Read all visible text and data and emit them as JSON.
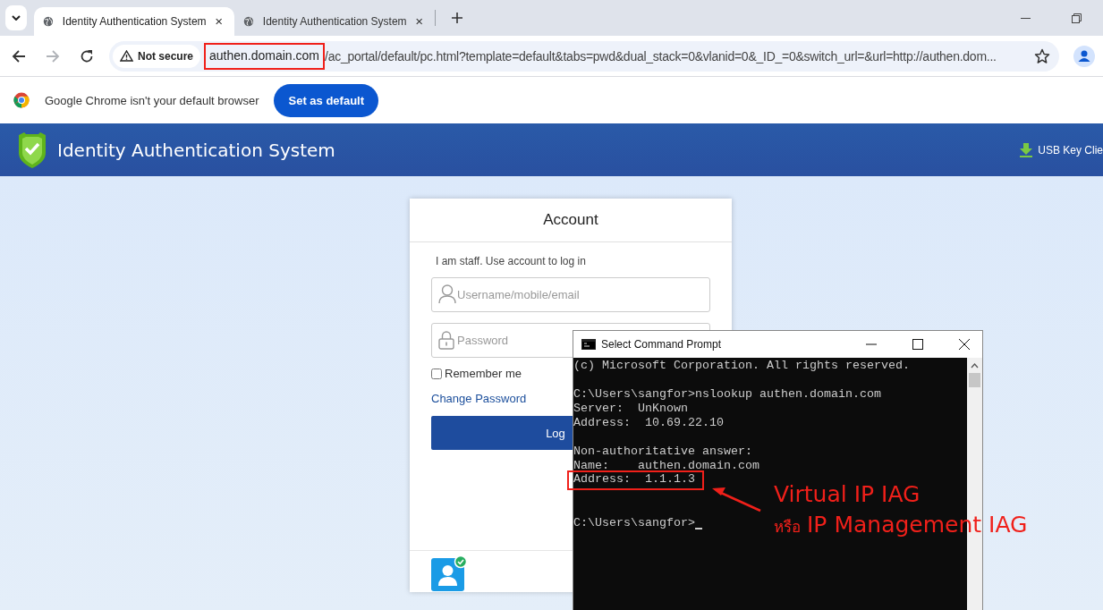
{
  "browser": {
    "tabs": [
      {
        "title": "Identity Authentication System",
        "selected": true
      },
      {
        "title": "Identity Authentication System",
        "selected": false
      }
    ],
    "toolbar": {
      "forward_disabled": true,
      "security_label": "Not secure",
      "url_host": "authen.domain.com",
      "url_host_highlighted": true,
      "url_rest": "/ac_portal/default/pc.html?template=default&tabs=pwd&dual_stack=0&vlanid=0&_ID_=0&switch_url=&url=http://authen.dom..."
    },
    "infobar": {
      "message": "Google Chrome isn't your default browser",
      "button": "Set as default"
    }
  },
  "page": {
    "header": {
      "title": "Identity Authentication System",
      "link": "USB Key Clie"
    },
    "login_card": {
      "title": "Account",
      "subtitle": "I am staff. Use account to log in",
      "username_placeholder": "Username/mobile/email",
      "password_placeholder": "Password",
      "remember": {
        "label": "Remember me",
        "checked": false
      },
      "change_password": "Change Password",
      "login_button": "Log"
    }
  },
  "command_prompt": {
    "title": "Select Command Prompt",
    "lines": [
      {
        "kind": "text",
        "text": "(c) Microsoft Corporation. All rights reserved.",
        "highlighted": false
      },
      {
        "kind": "blank"
      },
      {
        "kind": "text",
        "text": "C:\\Users\\sangfor>nslookup authen.domain.com",
        "highlighted": false
      },
      {
        "kind": "text",
        "text": "Server:  UnKnown",
        "highlighted": false
      },
      {
        "kind": "text",
        "text": "Address:  10.69.22.10",
        "highlighted": false
      },
      {
        "kind": "blank"
      },
      {
        "kind": "text",
        "text": "Non-authoritative answer:",
        "highlighted": false
      },
      {
        "kind": "text",
        "text": "Name:    authen.domain.com",
        "highlighted": false
      },
      {
        "kind": "text",
        "text": "Address:  1.1.1.3",
        "highlighted": true
      },
      {
        "kind": "blank"
      },
      {
        "kind": "blank"
      },
      {
        "kind": "prompt",
        "text": "C:\\Users\\sangfor>",
        "highlighted": false
      }
    ]
  },
  "annotation": {
    "title": "Virtual IP IAG",
    "connector": "หรือ",
    "subtitle": "IP Management IAG"
  }
}
